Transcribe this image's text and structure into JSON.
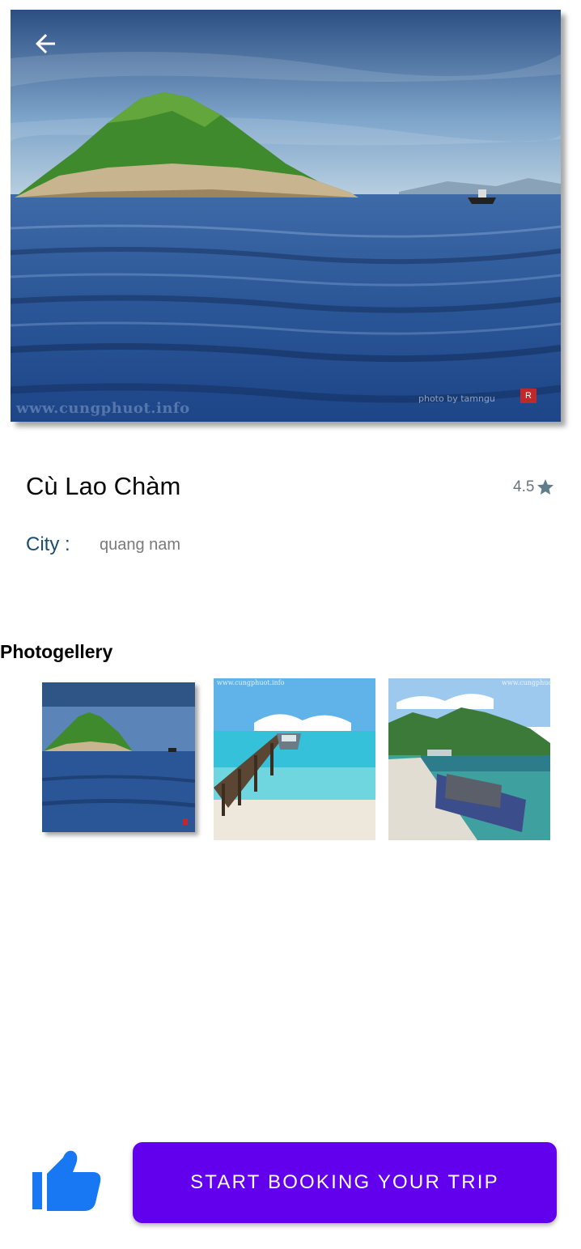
{
  "hero": {
    "watermark": "www.cungphuot.info",
    "photo_credit": "photo by tamngu",
    "stamp_text": "R"
  },
  "place": {
    "name": "Cù Lao Chàm",
    "rating": "4.5",
    "city_label": "City :",
    "city_value": "quang nam"
  },
  "gallery": {
    "title": "Photogellery",
    "thumb_watermark": "www.cungphuot.info"
  },
  "actions": {
    "booking_label": "START BOOKING YOUR TRIP"
  },
  "icons": {
    "back": "arrow-back-icon",
    "rating": "star-icon",
    "like": "thumb-up-icon"
  },
  "colors": {
    "primary": "#6200ee",
    "like_icon": "#1877f2",
    "city_label": "#1d4d6e",
    "star": "#607d8b"
  }
}
